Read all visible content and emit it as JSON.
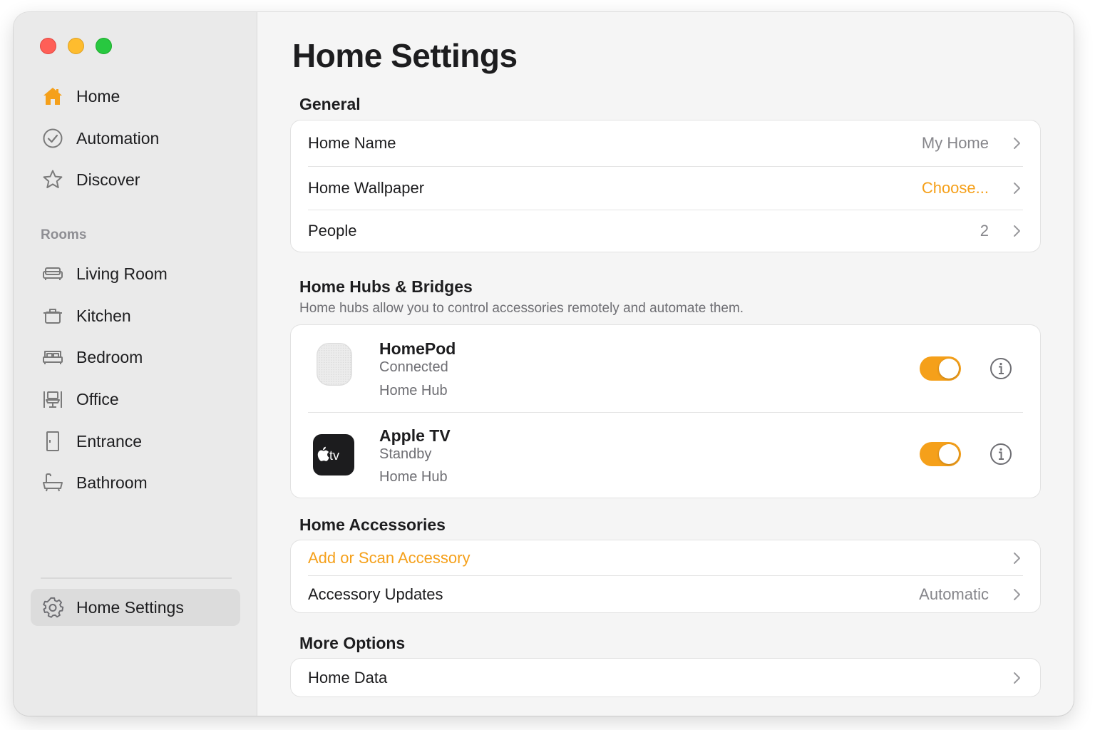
{
  "sidebar": {
    "nav": [
      {
        "label": "Home",
        "icon": "house-icon"
      },
      {
        "label": "Automation",
        "icon": "checkmark-circle-icon"
      },
      {
        "label": "Discover",
        "icon": "star-icon"
      }
    ],
    "rooms_heading": "Rooms",
    "rooms": [
      {
        "label": "Living Room",
        "icon": "sofa-icon"
      },
      {
        "label": "Kitchen",
        "icon": "pot-icon"
      },
      {
        "label": "Bedroom",
        "icon": "bed-icon"
      },
      {
        "label": "Office",
        "icon": "desk-chair-icon"
      },
      {
        "label": "Entrance",
        "icon": "door-icon"
      },
      {
        "label": "Bathroom",
        "icon": "bathtub-icon"
      }
    ],
    "settings_label": "Home Settings"
  },
  "main": {
    "title": "Home Settings",
    "general": {
      "heading": "General",
      "rows": [
        {
          "label": "Home Name",
          "value": "My Home"
        },
        {
          "label": "Home Wallpaper",
          "value": "Choose..."
        },
        {
          "label": "People",
          "value": "2"
        }
      ]
    },
    "hubs": {
      "heading": "Home Hubs & Bridges",
      "subtitle": "Home hubs allow you to control accessories remotely and automate them.",
      "items": [
        {
          "name": "HomePod",
          "status": "Connected",
          "role": "Home Hub",
          "enabled": true
        },
        {
          "name": "Apple TV",
          "status": "Standby",
          "role": "Home Hub",
          "enabled": true,
          "icon_text": "tv"
        }
      ]
    },
    "accessories": {
      "heading": "Home Accessories",
      "add_label": "Add or Scan Accessory",
      "updates_label": "Accessory Updates",
      "updates_value": "Automatic"
    },
    "more": {
      "heading": "More Options",
      "data_label": "Home Data"
    }
  },
  "colors": {
    "accent": "#f5a01a",
    "sidebar_bg": "#eaeaea",
    "content_bg": "#f5f5f5"
  }
}
